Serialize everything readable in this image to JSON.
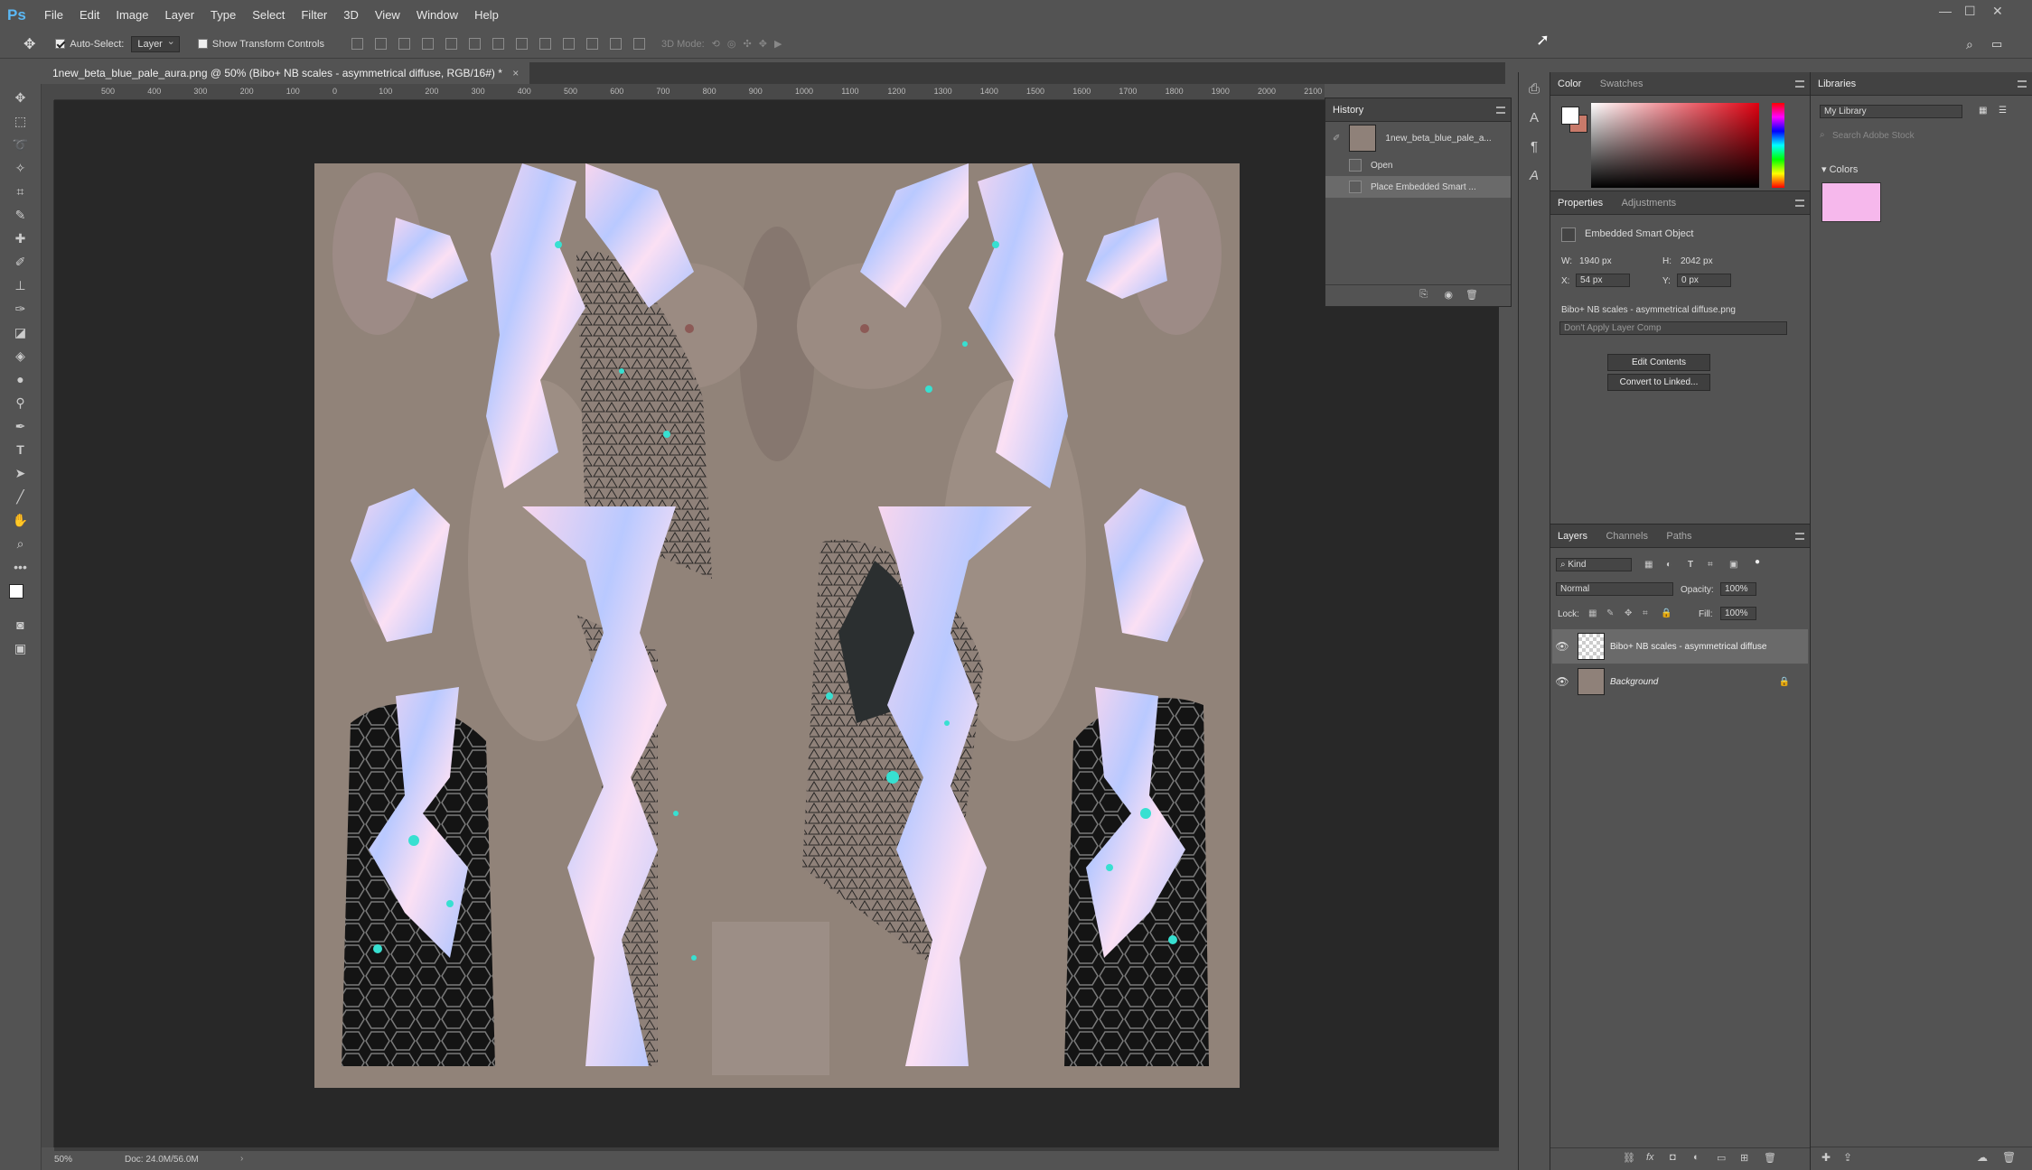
{
  "app": {
    "logo": "Ps"
  },
  "menu": [
    "File",
    "Edit",
    "Image",
    "Layer",
    "Type",
    "Select",
    "Filter",
    "3D",
    "View",
    "Window",
    "Help"
  ],
  "options": {
    "auto_select_label": "Auto-Select:",
    "auto_select_value": "Layer",
    "show_transform_label": "Show Transform Controls",
    "mode3d_label": "3D Mode:"
  },
  "document": {
    "tab_title": "1new_beta_blue_pale_aura.png @ 50% (Bibo+ NB scales - asymmetrical diffuse, RGB/16#) *",
    "zoom": "50%",
    "doc_size": "Doc: 24.0M/56.0M"
  },
  "ruler_ticks": [
    "500",
    "400",
    "300",
    "200",
    "100",
    "0",
    "100",
    "200",
    "300",
    "400",
    "500",
    "600",
    "700",
    "800",
    "900",
    "1000",
    "1100",
    "1200",
    "1300",
    "1400",
    "1500",
    "1600",
    "1700",
    "1800",
    "1900",
    "2000",
    "2100",
    "2200"
  ],
  "history": {
    "title": "History",
    "snapshot": "1new_beta_blue_pale_a...",
    "items": [
      "Open",
      "Place Embedded Smart ..."
    ]
  },
  "color_panel": {
    "tabs": [
      "Color",
      "Swatches"
    ],
    "fg": "#ffffff",
    "bg": "#c97a6a"
  },
  "properties": {
    "tabs": [
      "Properties",
      "Adjustments"
    ],
    "type": "Embedded Smart Object",
    "w_label": "W:",
    "w": "1940 px",
    "h_label": "H:",
    "h": "2042 px",
    "x_label": "X:",
    "x": "54 px",
    "y_label": "Y:",
    "y": "0 px",
    "filename": "Bibo+ NB scales - asymmetrical diffuse.png",
    "layer_comp": "Don't Apply Layer Comp",
    "edit_btn": "Edit Contents",
    "convert_btn": "Convert to Linked..."
  },
  "layers": {
    "tabs": [
      "Layers",
      "Channels",
      "Paths"
    ],
    "filter": "Kind",
    "blend": "Normal",
    "opacity_label": "Opacity:",
    "opacity": "100%",
    "lock_label": "Lock:",
    "fill_label": "Fill:",
    "fill": "100%",
    "items": [
      "Bibo+ NB scales - asymmetrical diffuse",
      "Background"
    ]
  },
  "libraries": {
    "title": "Libraries",
    "library": "My Library",
    "search_placeholder": "Search Adobe Stock",
    "colors_label": "Colors",
    "color_swatch": "#f6b8ec"
  }
}
